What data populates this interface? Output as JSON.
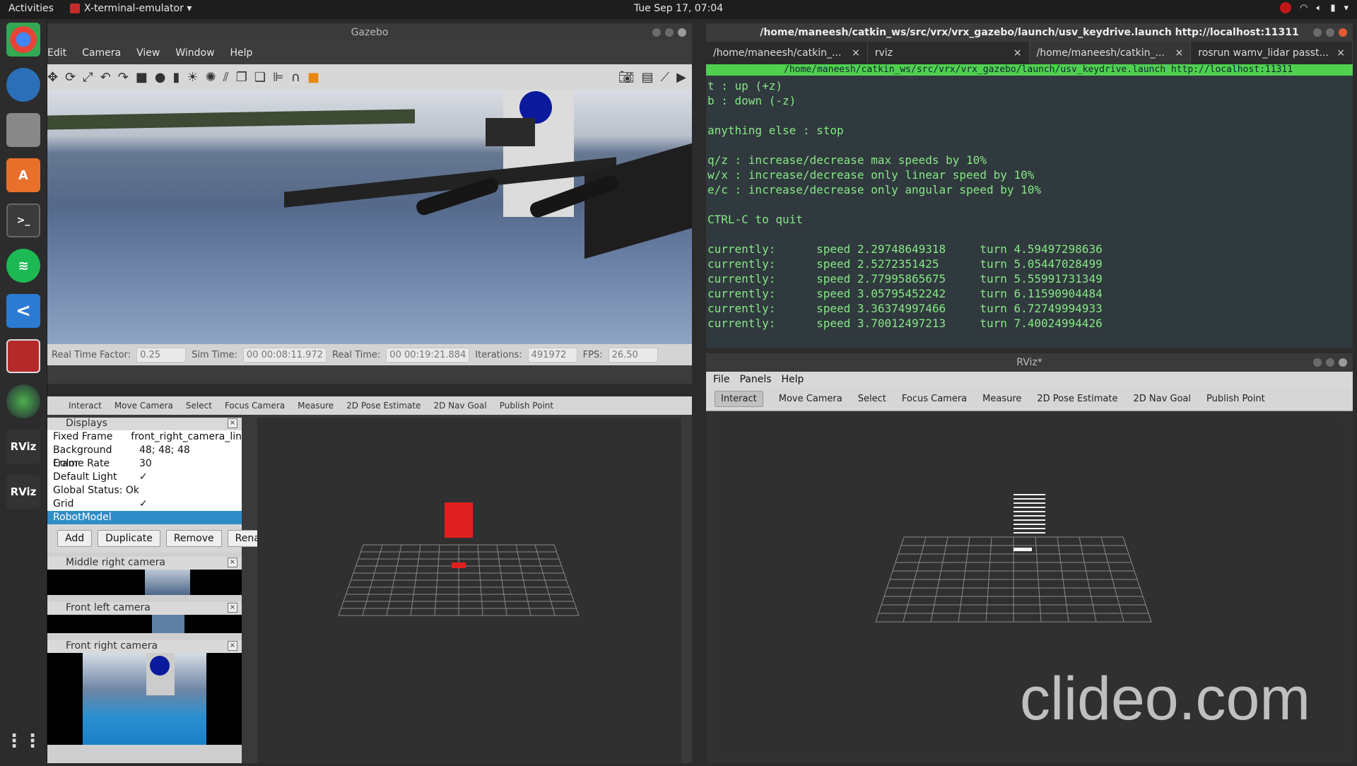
{
  "topbar": {
    "activities": "Activities",
    "app_name": "X-terminal-emulator ▾",
    "clock": "Tue Sep 17, 07:04",
    "tray": [
      "wifi-icon",
      "volume-icon",
      "battery-icon",
      "power-icon"
    ]
  },
  "dock": {
    "items": [
      "chrome-icon",
      "thunderbird-icon",
      "files-icon",
      "software-center-icon",
      "terminal-icon",
      "spotify-icon",
      "vscode-icon",
      "app-icon",
      "gazebo-icon",
      "rviz-icon",
      "rviz-icon",
      "apps-grid-icon"
    ],
    "rviz_label": "RViz",
    "rviz_label2": "RViz"
  },
  "gazebo": {
    "title": "Gazebo",
    "menu": [
      "Edit",
      "Camera",
      "View",
      "Window",
      "Help"
    ],
    "status": {
      "rtf_label": "Real Time Factor:",
      "rtf": "0.25",
      "sim_label": "Sim Time:",
      "sim": "00 00:08:11.972",
      "real_label": "Real Time:",
      "real": "00 00:19:21.884",
      "iter_label": "Iterations:",
      "iter": "491972",
      "fps_label": "FPS:",
      "fps": "26.50"
    }
  },
  "terminal": {
    "title": "/home/maneesh/catkin_ws/src/vrx/vrx_gazebo/launch/usv_keydrive.launch http://localhost:11311",
    "tabs": [
      {
        "label": "/home/maneesh/catkin_..."
      },
      {
        "label": "rviz"
      },
      {
        "label": "/home/maneesh/catkin_..."
      },
      {
        "label": "rosrun wamv_lidar passt..."
      }
    ],
    "bar": "/home/maneesh/catkin_ws/src/vrx/vrx_gazebo/launch/usv_keydrive.launch http://localhost:11311",
    "lines": [
      "t : up (+z)",
      "b : down (-z)",
      "",
      "anything else : stop",
      "",
      "q/z : increase/decrease max speeds by 10%",
      "w/x : increase/decrease only linear speed by 10%",
      "e/c : increase/decrease only angular speed by 10%",
      "",
      "CTRL-C to quit",
      "",
      "currently:      speed 2.29748649318     turn 4.59497298636",
      "currently:      speed 2.5272351425      turn 5.05447028499",
      "currently:      speed 2.77995865675     turn 5.55991731349",
      "currently:      speed 3.05795452242     turn 6.11590904484",
      "currently:      speed 3.36374997466     turn 6.72749994933",
      "currently:      speed 3.70012497213     turn 7.40024994426"
    ]
  },
  "rviz_left": {
    "tools": [
      "Interact",
      "Move Camera",
      "Select",
      "Focus Camera",
      "Measure",
      "2D Pose Estimate",
      "2D Nav Goal",
      "Publish Point"
    ],
    "displays_title": "Displays",
    "props": [
      {
        "k": "Fixed Frame",
        "v": "front_right_camera_lin"
      },
      {
        "k": "Background Color",
        "v": "48; 48; 48"
      },
      {
        "k": "Frame Rate",
        "v": "30"
      },
      {
        "k": "Default Light",
        "v": "✓"
      },
      {
        "k": "Global Status: Ok",
        "v": ""
      },
      {
        "k": "Grid",
        "v": "✓"
      },
      {
        "k": "RobotModel",
        "v": ""
      }
    ],
    "buttons": [
      "Add",
      "Duplicate",
      "Remove",
      "Rename"
    ],
    "cams": [
      "Middle right camera",
      "Front left camera",
      "Front right camera"
    ]
  },
  "rviz_right": {
    "title": "RViz*",
    "menu": [
      "File",
      "Panels",
      "Help"
    ],
    "tools": [
      "Interact",
      "Move Camera",
      "Select",
      "Focus Camera",
      "Measure",
      "2D Pose Estimate",
      "2D Nav Goal",
      "Publish Point"
    ]
  },
  "watermark": "clideo.com"
}
